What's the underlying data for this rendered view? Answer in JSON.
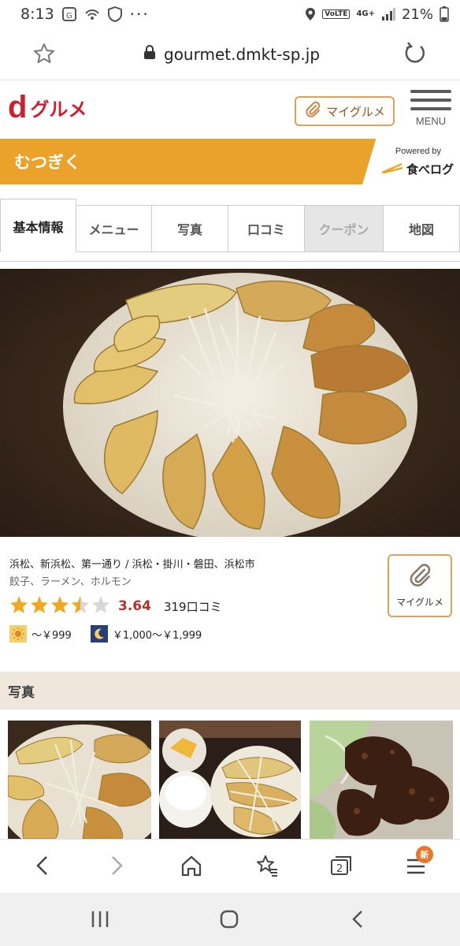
{
  "status": {
    "time": "8:13",
    "network": "4G+",
    "volte": "VoLTE",
    "battery": "21%"
  },
  "browser": {
    "url": "gourmet.dmkt-sp.jp"
  },
  "header": {
    "logo_d": "d",
    "logo_text": "グルメ",
    "mygurume_label": "マイグルメ",
    "menu_label": "MENU"
  },
  "restaurant": {
    "name": "むつぎく",
    "powered_by": "Powered by",
    "tabelog": "食べログ"
  },
  "tabs": [
    {
      "label": "基本情報",
      "state": "active"
    },
    {
      "label": "メニュー",
      "state": "normal"
    },
    {
      "label": "写真",
      "state": "normal"
    },
    {
      "label": "口コミ",
      "state": "normal"
    },
    {
      "label": "クーポン",
      "state": "disabled"
    },
    {
      "label": "地図",
      "state": "normal"
    }
  ],
  "info": {
    "area": "浜松、新浜松、第一通り / 浜松・掛川・磐田、浜松市",
    "genre": "餃子、ラーメン、ホルモン",
    "rating_stars": 3.5,
    "score": "3.64",
    "reviews": "319口コミ",
    "lunch_price": "～￥999",
    "dinner_price": "￥1,000～￥1,999",
    "mygurume_label": "マイグルメ"
  },
  "photos": {
    "heading": "写真"
  },
  "bottom_bar": {
    "new_badge": "新",
    "tab_count": "2"
  },
  "colors": {
    "brand_red": "#cc1f2f",
    "accent_orange": "#eaa22a",
    "score_red": "#b0332a"
  }
}
